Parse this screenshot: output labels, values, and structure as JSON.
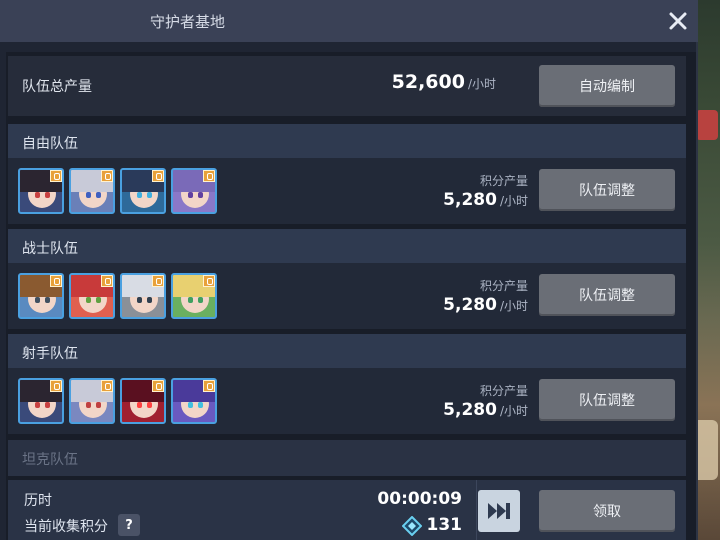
{
  "title": "守护者基地",
  "total": {
    "label": "队伍总产量",
    "value": "52,600",
    "unit": "/小时",
    "button": "自动编制"
  },
  "teams": [
    {
      "name": "自由队伍",
      "prod_label": "积分产量",
      "prod_value": "5,280",
      "unit": "/小时",
      "button": "队伍调整",
      "avatars": [
        {
          "hair": "#2b2530",
          "bg": "#3a4a7a",
          "eye": "#c84040"
        },
        {
          "hair": "#c8cad8",
          "bg": "#6a80b8",
          "eye": "#4060c0"
        },
        {
          "hair": "#2a3a5a",
          "bg": "#2e6a9a",
          "eye": "#40b0e0"
        },
        {
          "hair": "#7a6ab8",
          "bg": "#8a78c8",
          "eye": "#6040a0"
        }
      ]
    },
    {
      "name": "战士队伍",
      "prod_label": "积分产量",
      "prod_value": "5,280",
      "unit": "/小时",
      "button": "队伍调整",
      "avatars": [
        {
          "hair": "#8a5a30",
          "bg": "#5a8ac0",
          "eye": "#405060"
        },
        {
          "hair": "#c83a3a",
          "bg": "#e06050",
          "eye": "#60a040"
        },
        {
          "hair": "#d8dce4",
          "bg": "#8a9098",
          "eye": "#304050"
        },
        {
          "hair": "#e8d070",
          "bg": "#6ab060",
          "eye": "#40a060"
        }
      ]
    },
    {
      "name": "射手队伍",
      "prod_label": "积分产量",
      "prod_value": "5,280",
      "unit": "/小时",
      "button": "队伍调整",
      "avatars": [
        {
          "hair": "#2b2530",
          "bg": "#3a4a7a",
          "eye": "#c84040"
        },
        {
          "hair": "#c8cad8",
          "bg": "#7a88c0",
          "eye": "#c04040"
        },
        {
          "hair": "#5a1020",
          "bg": "#a02030",
          "eye": "#ff4040"
        },
        {
          "hair": "#4a3a9a",
          "bg": "#6a5ac0",
          "eye": "#40c0e0"
        }
      ]
    }
  ],
  "tank_team": {
    "name": "坦克队伍"
  },
  "bottom": {
    "elapsed_label": "历时",
    "elapsed_value": "00:00:09",
    "collect_label": "当前收集积分",
    "help": "?",
    "points_value": "131",
    "claim_button": "领取"
  }
}
